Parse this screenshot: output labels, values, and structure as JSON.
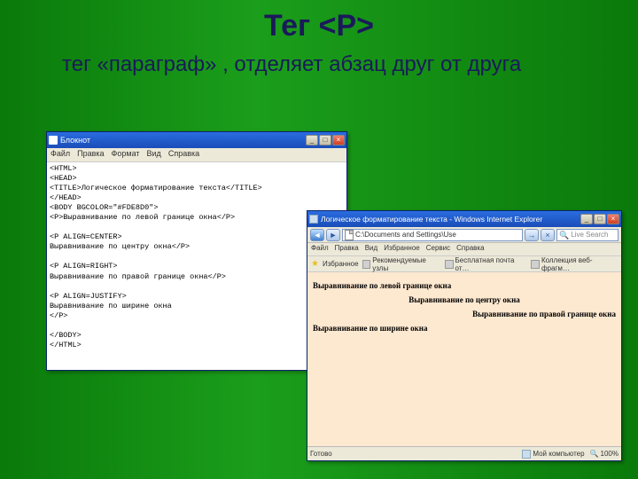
{
  "slide": {
    "title": "Тег <P>",
    "subtitle": "тег «параграф» , отделяет абзац друг от друга"
  },
  "notepad": {
    "title": "Блокнот",
    "menu": [
      "Файл",
      "Правка",
      "Формат",
      "Вид",
      "Справка"
    ],
    "code": "<HTML>\n<HEAD>\n<TITLE>Логическое форматирование текста</TITLE>\n</HEAD>\n<BODY BGCOLOR=\"#FDE8D0\">\n<P>Выравнивание по левой границе окна</P>\n\n<P ALIGN=CENTER>\nВыравнивание по центру окна</P>\n\n<P ALIGN=RIGHT>\nВыравнивание по правой границе окна</P>\n\n<P ALIGN=JUSTIFY>\nВыравнивание по ширине окна\n</P>\n\n</BODY>\n</HTML>"
  },
  "browser": {
    "title": "Логическое форматирование текста - Windows Internet Explorer",
    "address": "C:\\Documents and Settings\\Use",
    "search_placeholder": "Live Search",
    "menu": [
      "Файл",
      "Правка",
      "Вид",
      "Избранное",
      "Сервис",
      "Справка"
    ],
    "toolbar": {
      "fav": "Избранное",
      "items": [
        "Рекомендуемые узлы",
        "Бесплатная почта от…",
        "Коллекция веб-фрагм…"
      ]
    },
    "lines": {
      "left": "Выравнивание по левой границе окна",
      "center": "Выравнивание по центру окна",
      "right": "Выравнивание по правой границе окна",
      "justify": "Выравнивание по ширине окна"
    },
    "status": {
      "left": "Готово",
      "zone": "Мой компьютер",
      "zoom": "100%"
    }
  }
}
